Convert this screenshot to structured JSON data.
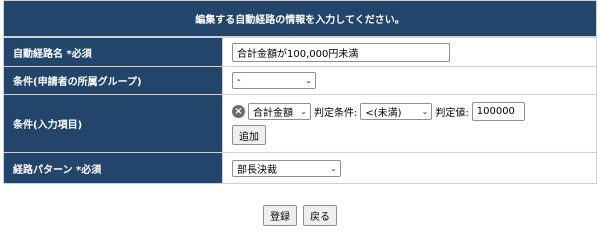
{
  "header": {
    "title": "編集する自動経路の情報を入力してください。"
  },
  "rows": {
    "route_name": {
      "label": "自動経路名 *必須",
      "value": "合計金額が100,000円未満"
    },
    "condition_group": {
      "label": "条件(申請者の所属グループ)",
      "selected": "-"
    },
    "condition_input": {
      "label": "条件(入力項目)",
      "field_selected": "合計金額",
      "judge_label": "判定条件:",
      "judge_selected": "<(未満)",
      "value_label": "判定値:",
      "value": "100000",
      "add_label": "追加"
    },
    "route_pattern": {
      "label": "経路パターン *必須",
      "selected": "部長決裁"
    }
  },
  "actions": {
    "register_label": "登録",
    "back_label": "戻る"
  }
}
